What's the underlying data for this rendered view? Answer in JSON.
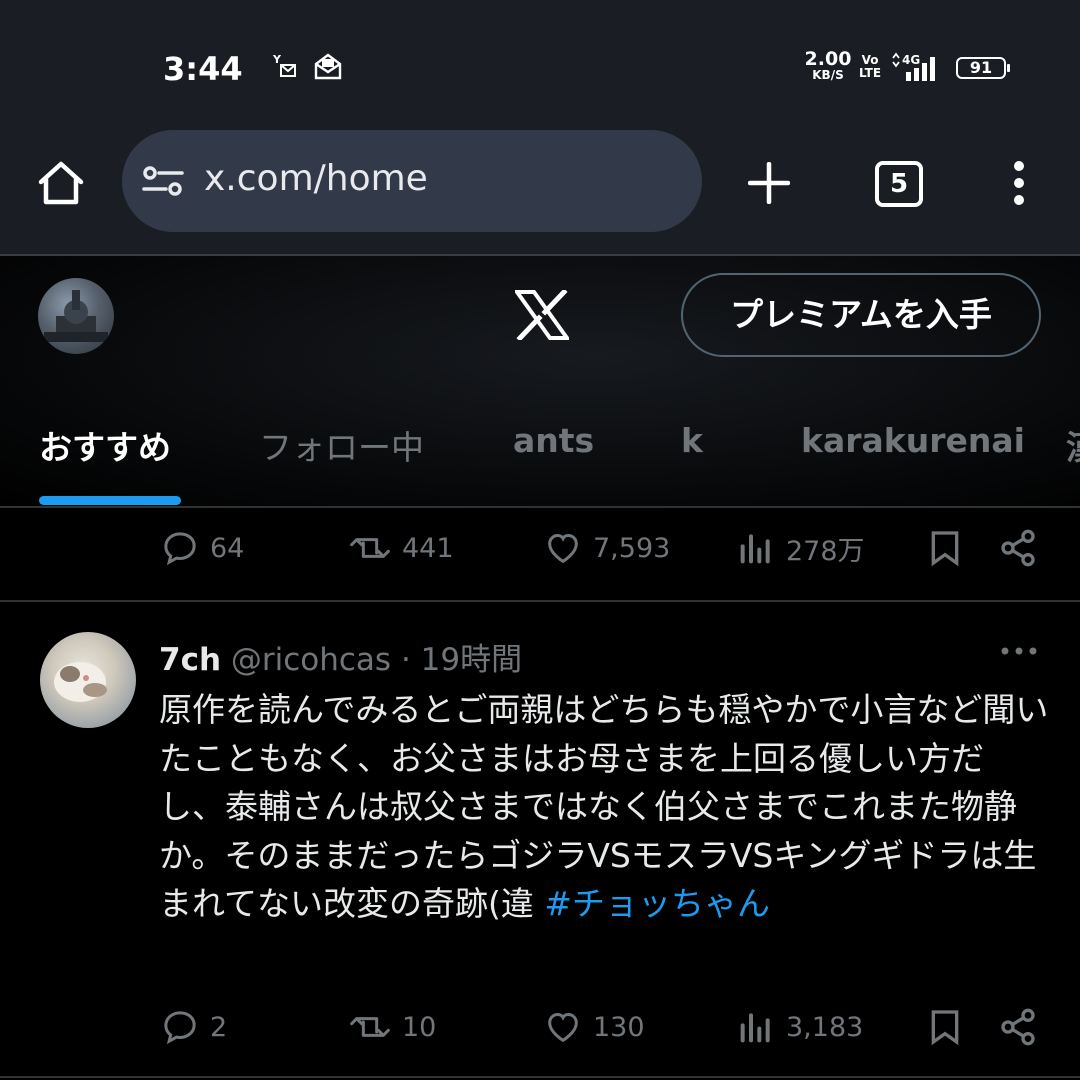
{
  "status_bar": {
    "time": "3:44",
    "net_speed_value": "2.00",
    "net_speed_unit": "KB/S",
    "volte_line1": "Vo",
    "volte_line2": "LTE",
    "network": "4G",
    "battery": "91"
  },
  "browser": {
    "url": "x.com/home",
    "tab_count": "5"
  },
  "header": {
    "premium_label": "プレミアムを入手"
  },
  "tabs": [
    {
      "label": "おすすめ",
      "active": true
    },
    {
      "label": "フォロー中",
      "active": false
    },
    {
      "label": "ants",
      "active": false
    },
    {
      "label": "k",
      "active": false
    },
    {
      "label": "karakurenai",
      "active": false
    },
    {
      "label": "漢",
      "active": false
    }
  ],
  "prev_post_actions": {
    "replies": "64",
    "reposts": "441",
    "likes": "7,593",
    "views": "278万"
  },
  "post": {
    "display_name": "7ch",
    "handle": "@ricohcas",
    "separator": " · ",
    "time": "19時間",
    "text": "原作を読んでみるとご両親はどちらも穏やかで小言など聞いたこともなく、お父さまはお母さまを上回る優しい方だし、泰輔さんは叔父さまではなく伯父さまでこれまた物静か。そのままだったらゴジラVSモスラVSキングギドラは生まれてない改変の奇跡(違 ",
    "hashtag": "#チョッちゃん",
    "actions": {
      "replies": "2",
      "reposts": "10",
      "likes": "130",
      "views": "3,183"
    }
  },
  "colors": {
    "accent": "#1d9bf0",
    "muted": "#71767b",
    "text": "#e7e9ea",
    "status_bar_bg": "#1a1d24",
    "url_box_bg": "#323a4a"
  }
}
